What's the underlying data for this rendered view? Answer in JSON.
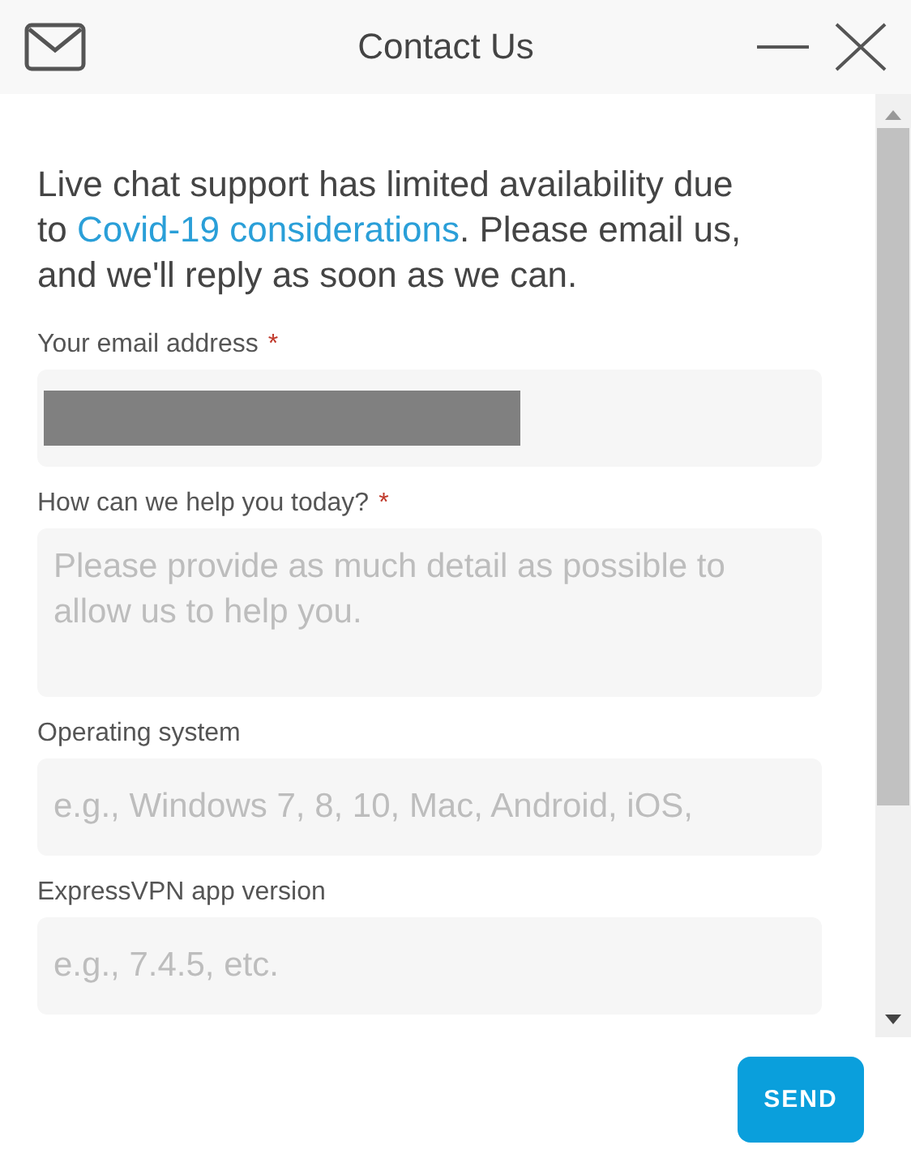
{
  "window": {
    "title": "Contact Us"
  },
  "intro": {
    "text": "Live chat support has limited availability due to ",
    "link": "Covid-19 considerations",
    "after": ". Please email us, and we'll reply as soon as we can."
  },
  "fields": [
    {
      "kind": "input",
      "label": "Your email address",
      "required_mark": "*",
      "redacted": true
    },
    {
      "kind": "textarea",
      "label": "How can we help you today?",
      "required_mark": "*",
      "placeholder": "Please provide as much detail as possible to allow us to help you."
    },
    {
      "kind": "input",
      "label": "Operating system",
      "placeholder": "e.g., Windows 7, 8, 10, Mac, Android, iOS,"
    },
    {
      "kind": "input",
      "label": "ExpressVPN app version",
      "placeholder": "e.g., 7.4.5, etc."
    }
  ],
  "buttons": [
    "SEND"
  ]
}
